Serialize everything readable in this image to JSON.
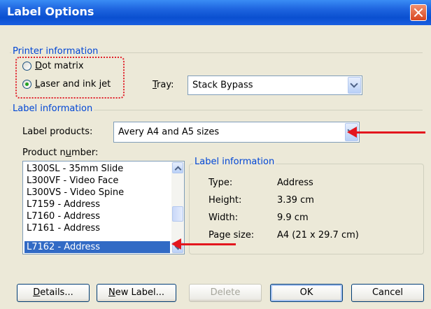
{
  "window": {
    "title": "Label Options"
  },
  "printer": {
    "group_label": "Printer information",
    "options": [
      {
        "label_first": "D",
        "label_rest": "ot matrix",
        "checked": false
      },
      {
        "label_first": "L",
        "label_rest": "aser and ink jet",
        "checked": true
      }
    ],
    "tray_label_first": "T",
    "tray_label_rest": "ray:",
    "tray_value": "Stack Bypass"
  },
  "label_info": {
    "group_label": "Label information",
    "products_label": "Label products:",
    "products_value": "Avery A4 and A5 sizes",
    "number_label_pre": "Product n",
    "number_label_u": "u",
    "number_label_post": "mber:",
    "products": [
      "L300SL - 35mm Slide",
      "L300VF - Video Face",
      "L300VS - Video Spine",
      "L7159 - Address",
      "L7160 - Address",
      "L7161 - Address",
      "L7162 - Address"
    ],
    "selected_index": 6
  },
  "details": {
    "title": "Label information",
    "rows": [
      {
        "key": "Type:",
        "value": "Address"
      },
      {
        "key": "Height:",
        "value": "3.39 cm"
      },
      {
        "key": "Width:",
        "value": "9.9 cm"
      },
      {
        "key": "Page size:",
        "value": "A4 (21 x 29.7 cm)"
      }
    ]
  },
  "buttons": {
    "details_first": "D",
    "details_rest": "etails...",
    "new_label_first": "N",
    "new_label_rest": "ew Label...",
    "delete": "Delete",
    "ok": "OK",
    "cancel": "Cancel"
  },
  "annotations": {
    "arrow_color": "#e3161e",
    "highlight_color": "#e0202a"
  }
}
